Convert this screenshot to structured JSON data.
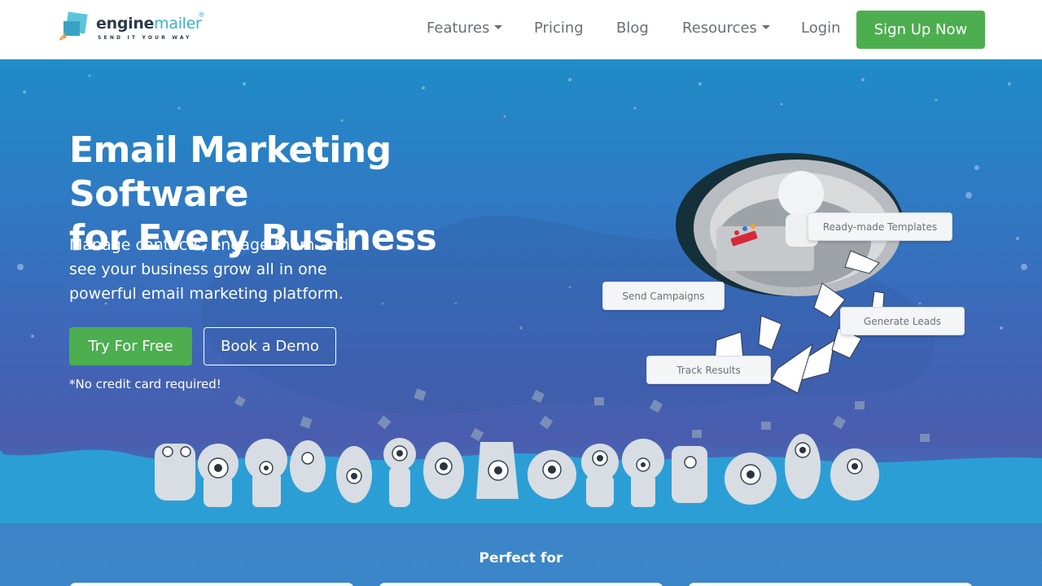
{
  "brand": {
    "name_part1": "engine",
    "name_part2": "mailer",
    "registered": "®",
    "tagline": "SEND IT YOUR WAY"
  },
  "nav": {
    "items": [
      {
        "label": "Features",
        "dropdown": true
      },
      {
        "label": "Pricing",
        "dropdown": false
      },
      {
        "label": "Blog",
        "dropdown": false
      },
      {
        "label": "Resources",
        "dropdown": true
      },
      {
        "label": "Login",
        "dropdown": false
      }
    ],
    "cta_label": "Sign Up Now"
  },
  "hero": {
    "title_line1": "Email Marketing Software",
    "title_line2": "for Every Business",
    "subtitle_line1": "Manage contacts, engage them and",
    "subtitle_line2": "see your business grow all in one",
    "subtitle_line3": "powerful email marketing platform.",
    "primary_button": "Try For Free",
    "secondary_button": "Book a Demo",
    "note": "*No credit card required!"
  },
  "illustration": {
    "labels": {
      "templates": "Ready-made Templates",
      "send": "Send Campaigns",
      "leads": "Generate Leads",
      "track": "Track Results"
    }
  },
  "section": {
    "perfect_for": "Perfect for"
  },
  "colors": {
    "primary_green": "#4cae4f",
    "nav_text": "#6b6f75",
    "brand_teal": "#3bb0c9",
    "hero_top": "#1f8cc6",
    "hero_mid": "#4a5cae"
  }
}
